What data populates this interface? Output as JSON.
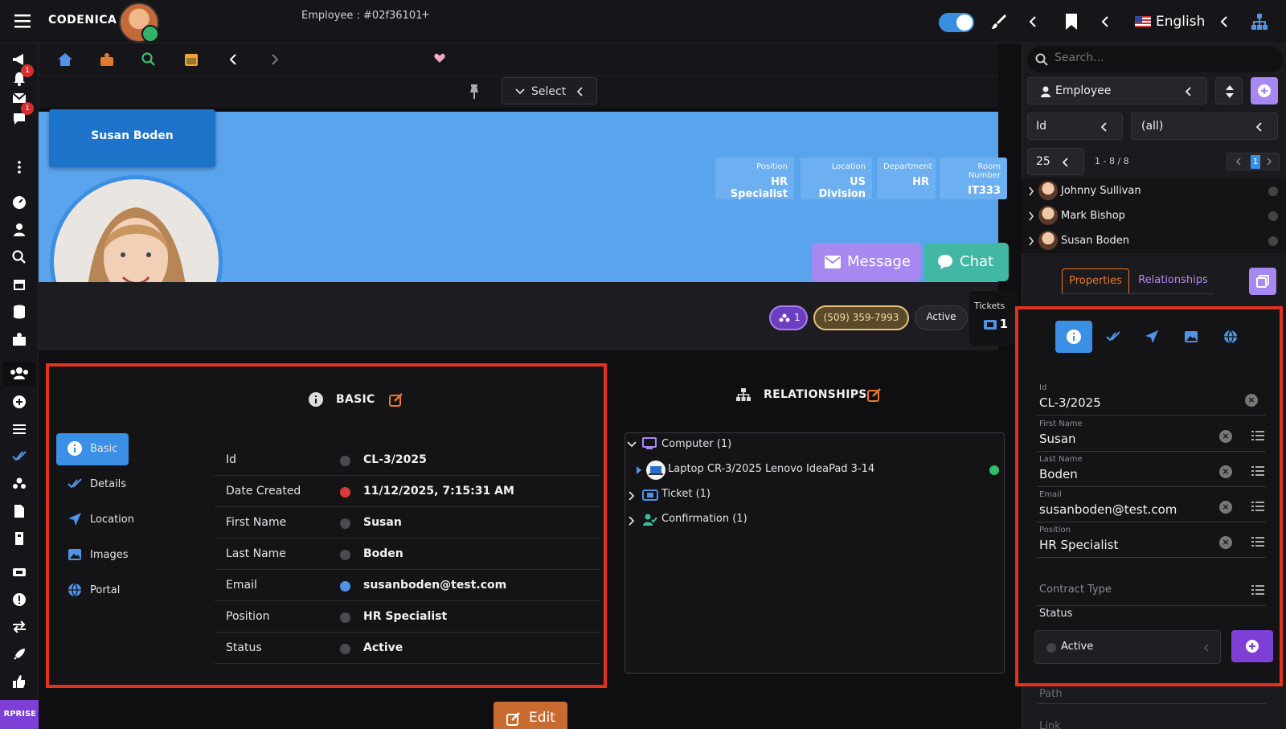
{
  "brand": "CODENICA",
  "language": "English",
  "breadcrumb": "Employee : #02f36101",
  "breadcrumb_plus": "+",
  "select_label": "Select",
  "employee": {
    "name": "Susan Boden",
    "position_label": "Position",
    "position": "HR Specialist",
    "location_label": "Location",
    "location": "US Division",
    "department_label": "Department",
    "department": "HR",
    "room_label": "Room Number",
    "room": "IT333",
    "phone": "(509) 359-7993",
    "group_count": "1",
    "status": "Active",
    "tickets_label": "Tickets",
    "tickets_count": "1"
  },
  "actions": {
    "message": "Message",
    "chat": "Chat",
    "edit": "Edit"
  },
  "rail_badges": {
    "notifications": "1",
    "chat": "1"
  },
  "enterprise": "RPRISE",
  "basic": {
    "title": "BASIC",
    "nav": [
      "Basic",
      "Details",
      "Location",
      "Images",
      "Portal"
    ],
    "rows": [
      {
        "key": "Id",
        "value": "CL-3/2025"
      },
      {
        "key": "Date Created",
        "value": "11/12/2025, 7:15:31 AM"
      },
      {
        "key": "First Name",
        "value": "Susan"
      },
      {
        "key": "Last Name",
        "value": "Boden"
      },
      {
        "key": "Email",
        "value": "susanboden@test.com"
      },
      {
        "key": "Position",
        "value": "HR Specialist"
      },
      {
        "key": "Status",
        "value": "Active"
      }
    ]
  },
  "relationships": {
    "title": "RELATIONSHIPS",
    "computer": "Computer (1)",
    "laptop": "Laptop CR-3/2025 Lenovo IdeaPad 3-14",
    "ticket": "Ticket (1)",
    "confirmation": "Confirmation (1)"
  },
  "right": {
    "search_placeholder": "Search...",
    "entity": "Employee",
    "filter_field": "Id",
    "filter_value": "(all)",
    "page_size": "25",
    "range": "1 - 8 / 8",
    "page": "1",
    "employees": [
      "Johnny Sullivan",
      "Mark Bishop",
      "Susan Boden"
    ],
    "tab_properties": "Properties",
    "tab_relationships": "Relationships",
    "fields": [
      {
        "key": "Id",
        "value": "CL-3/2025"
      },
      {
        "key": "First Name",
        "value": "Susan"
      },
      {
        "key": "Last Name",
        "value": "Boden"
      },
      {
        "key": "Email",
        "value": "susanboden@test.com"
      },
      {
        "key": "Position",
        "value": "HR Specialist"
      }
    ],
    "contract_type_placeholder": "Contract Type",
    "status_label": "Status",
    "status_value": "Active",
    "path_placeholder": "Path",
    "link_placeholder": "Link"
  },
  "colors": {
    "accent_blue": "#3b8fe4",
    "hero_blue": "#5aa4ee",
    "highlight_red": "#e0321f",
    "purple": "#7d3fd6",
    "edit_orange": "#c96a2f"
  }
}
